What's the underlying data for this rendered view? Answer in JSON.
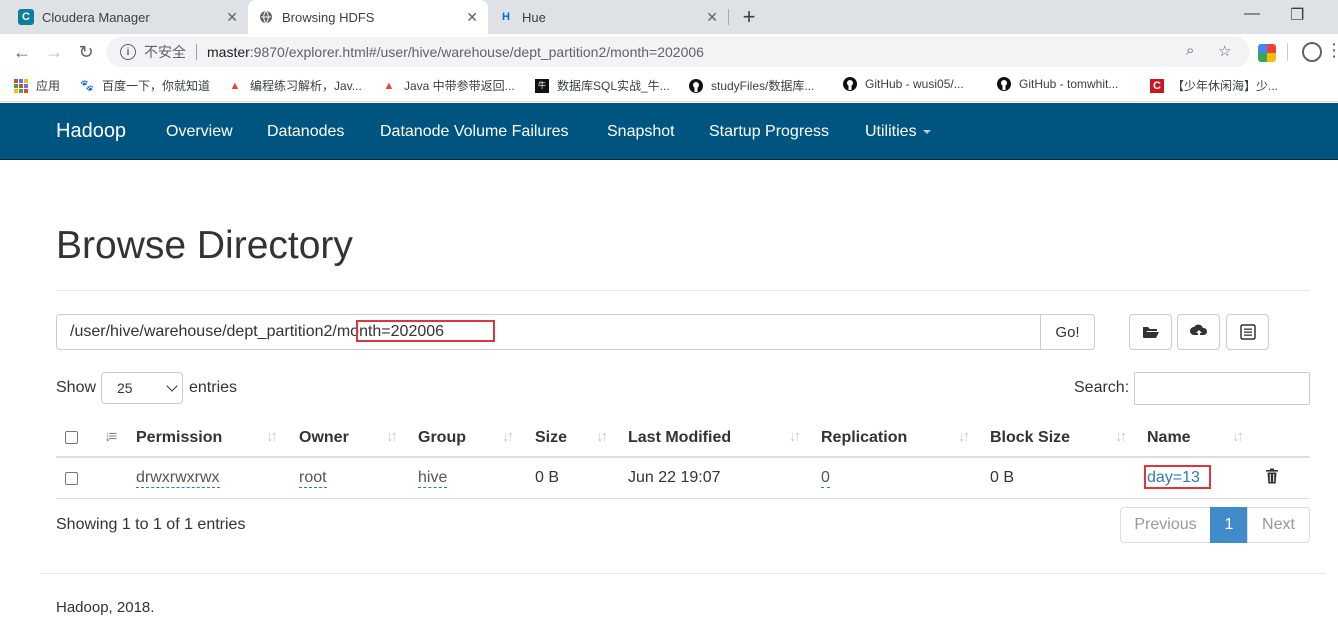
{
  "browser": {
    "tabs": [
      {
        "title": "Cloudera Manager",
        "favicon": "C"
      },
      {
        "title": "Browsing HDFS",
        "favicon": "globe"
      },
      {
        "title": "Hue",
        "favicon": "H"
      }
    ],
    "omnibox": {
      "security_label": "不安全",
      "url_host": "master",
      "url_rest": ":9870/explorer.html#/user/hive/warehouse/dept_partition2/month=202006"
    },
    "bookmarks": [
      {
        "label": "应用",
        "icon": "apps-grid-icon"
      },
      {
        "label": "百度一下，你就知道",
        "icon": "baidu-paw-icon"
      },
      {
        "label": "编程练习解析，Jav...",
        "icon": "flame-icon"
      },
      {
        "label": "Java 中带参带返回...",
        "icon": "flame-icon"
      },
      {
        "label": "数据库SQL实战_牛...",
        "icon": "nowcoder-icon"
      },
      {
        "label": "studyFiles/数据库...",
        "icon": "github-icon"
      },
      {
        "label": "GitHub - wusi05/...",
        "icon": "github-icon"
      },
      {
        "label": "GitHub - tomwhit...",
        "icon": "github-icon"
      },
      {
        "label": "【少年休闲海】少...",
        "icon": "csdn-icon"
      }
    ]
  },
  "navbar": {
    "brand": "Hadoop",
    "items": [
      "Overview",
      "Datanodes",
      "Datanode Volume Failures",
      "Snapshot",
      "Startup Progress",
      "Utilities"
    ]
  },
  "page": {
    "title": "Browse Directory",
    "path_value": "/user/hive/warehouse/dept_partition2/month=202006",
    "go_label": "Go!",
    "show_label": "Show",
    "entries_value": "25",
    "entries_label": "entries",
    "search_label": "Search:",
    "search_value": ""
  },
  "table": {
    "headers": [
      "Permission",
      "Owner",
      "Group",
      "Size",
      "Last Modified",
      "Replication",
      "Block Size",
      "Name"
    ],
    "rows": [
      {
        "permission": "drwxrwxrwx",
        "owner": "root",
        "group": "hive",
        "size": "0 B",
        "last_modified": "Jun 22 19:07",
        "replication": "0",
        "block_size": "0 B",
        "name": "day=13"
      }
    ]
  },
  "pagination": {
    "info": "Showing 1 to 1 of 1 entries",
    "previous": "Previous",
    "current": "1",
    "next": "Next"
  },
  "footer": {
    "text": "Hadoop, 2018."
  },
  "colors": {
    "navbar_bg": "#005580",
    "link": "#337ab7",
    "pager_active": "#428bca",
    "highlight_box": "#d9363e"
  }
}
